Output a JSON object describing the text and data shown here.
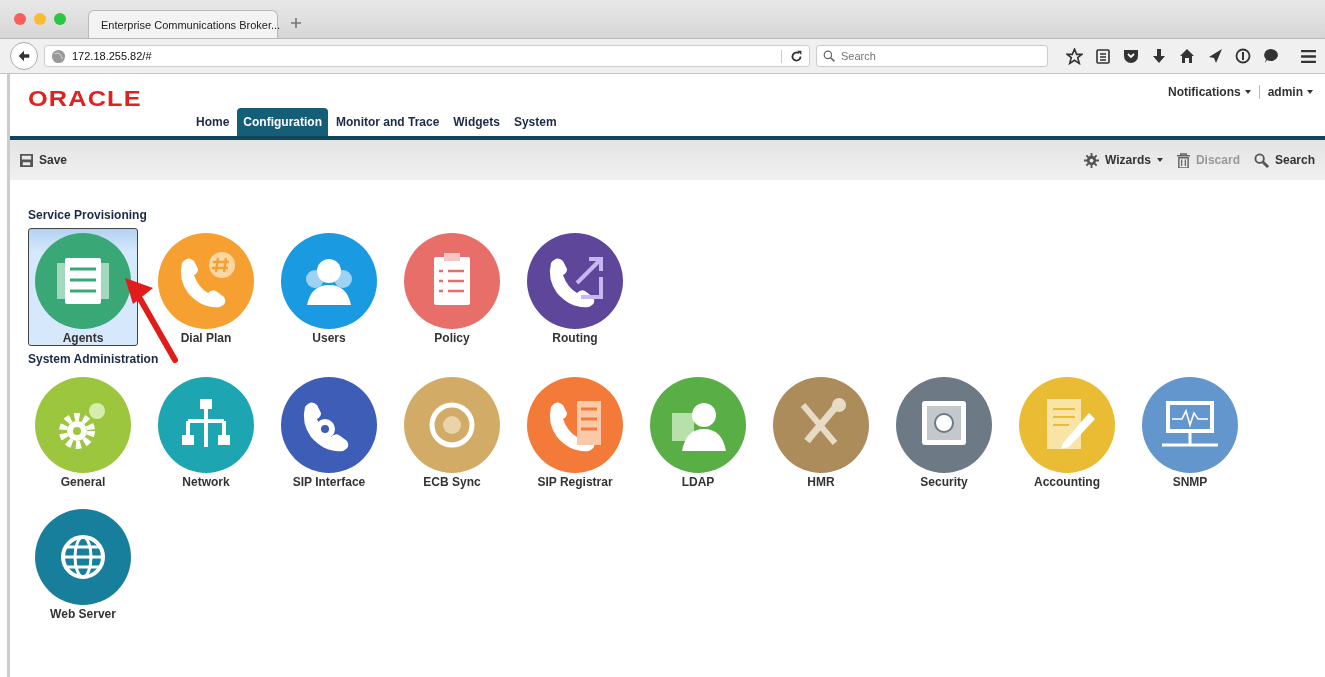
{
  "browser": {
    "tab_title": "Enterprise Communications Broker...",
    "url": "172.18.255.82/#",
    "search": {
      "placeholder": "Search"
    }
  },
  "header": {
    "logo": "ORACLE",
    "nav": [
      {
        "label": "Home",
        "selected": false
      },
      {
        "label": "Configuration",
        "selected": true
      },
      {
        "label": "Monitor and Trace",
        "selected": false
      },
      {
        "label": "Widgets",
        "selected": false
      },
      {
        "label": "System",
        "selected": false
      }
    ],
    "user_menu": [
      "Notifications",
      "admin"
    ]
  },
  "toolbar": {
    "save": "Save",
    "wizards": "Wizards",
    "discard": {
      "label": "Discard",
      "disabled": true
    },
    "search": "Search"
  },
  "sections": [
    {
      "title": "Service Provisioning",
      "tiles": [
        {
          "label": "Agents",
          "color": "#3aa876",
          "selected": true
        },
        {
          "label": "Dial Plan",
          "color": "#f5a031",
          "selected": false
        },
        {
          "label": "Users",
          "color": "#1a9ae0",
          "selected": false
        },
        {
          "label": "Policy",
          "color": "#e86e6a",
          "selected": false
        },
        {
          "label": "Routing",
          "color": "#5e479a",
          "selected": false
        }
      ]
    },
    {
      "title": "System Administration",
      "tiles": [
        {
          "label": "General",
          "color": "#9cc63e",
          "selected": false
        },
        {
          "label": "Network",
          "color": "#1ea5b2",
          "selected": false
        },
        {
          "label": "SIP Interface",
          "color": "#3e5db6",
          "selected": false
        },
        {
          "label": "ECB Sync",
          "color": "#d2ac66",
          "selected": false
        },
        {
          "label": "SIP Registrar",
          "color": "#f47a3a",
          "selected": false
        },
        {
          "label": "LDAP",
          "color": "#5aae46",
          "selected": false
        },
        {
          "label": "HMR",
          "color": "#ad8c5c",
          "selected": false
        },
        {
          "label": "Security",
          "color": "#6d7985",
          "selected": false
        },
        {
          "label": "Accounting",
          "color": "#e9bc33",
          "selected": false
        },
        {
          "label": "SNMP",
          "color": "#6296cc",
          "selected": false
        },
        {
          "label": "Web Server",
          "color": "#177f9c",
          "selected": false
        }
      ]
    }
  ]
}
